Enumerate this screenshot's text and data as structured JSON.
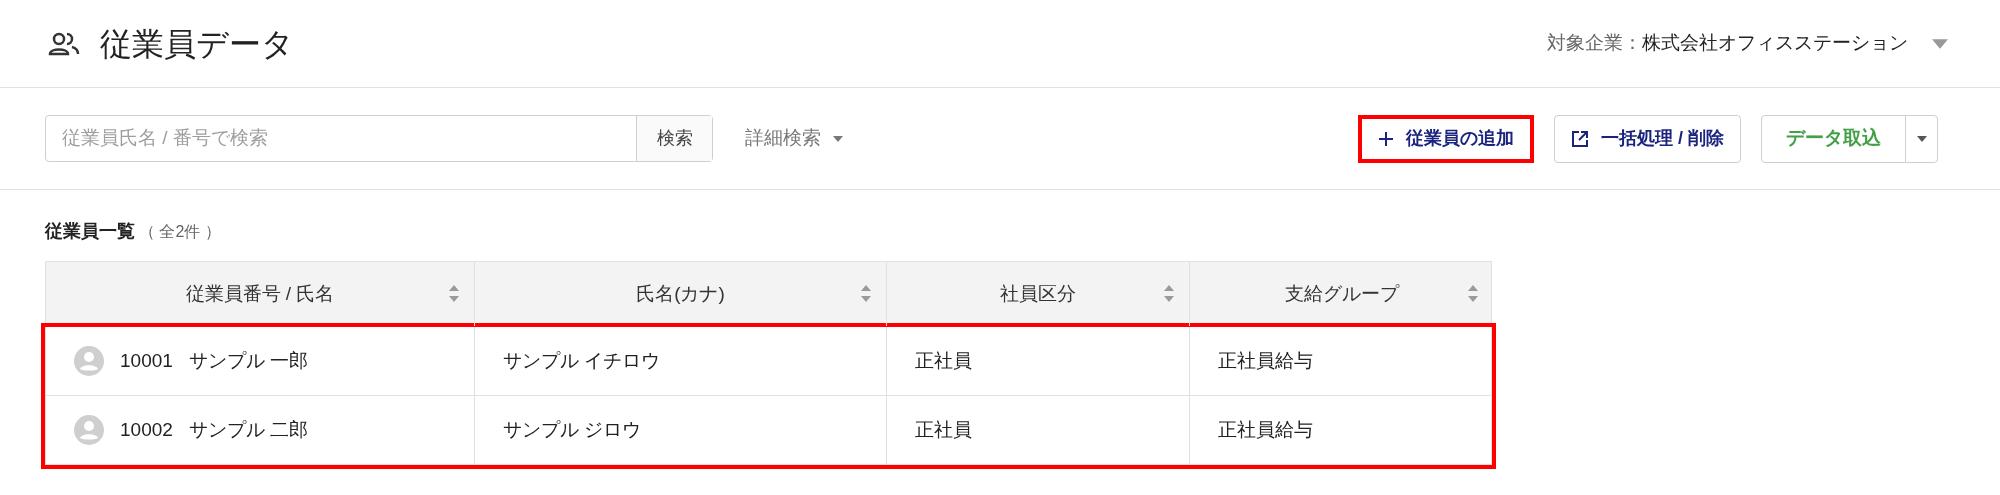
{
  "page": {
    "title": "従業員データ",
    "company_label": "対象企業：",
    "company_name": "株式会社オフィスステーション"
  },
  "toolbar": {
    "search": {
      "placeholder": "従業員氏名 / 番号で検索",
      "button": "検索"
    },
    "advanced_search": "詳細検索",
    "buttons": [
      {
        "kind": "add",
        "label": "従業員の追加",
        "highlighted": true
      },
      {
        "kind": "bulk",
        "label": "一括処理 / 削除",
        "highlighted": false
      },
      {
        "kind": "import",
        "label": "データ取込",
        "highlighted": false
      }
    ]
  },
  "list": {
    "title": "従業員一覧",
    "count": "（ 全2件 ）",
    "rows_highlighted": true,
    "columns": [
      "従業員番号 / 氏名",
      "氏名(カナ)",
      "社員区分",
      "支給グループ"
    ],
    "rows": [
      {
        "number": "10001",
        "name": "サンプル 一郎",
        "kana": "サンプル イチロウ",
        "type": "正社員",
        "group": "正社員給与"
      },
      {
        "number": "10002",
        "name": "サンプル 二郎",
        "kana": "サンプル ジロウ",
        "type": "正社員",
        "group": "正社員給与"
      }
    ]
  }
}
